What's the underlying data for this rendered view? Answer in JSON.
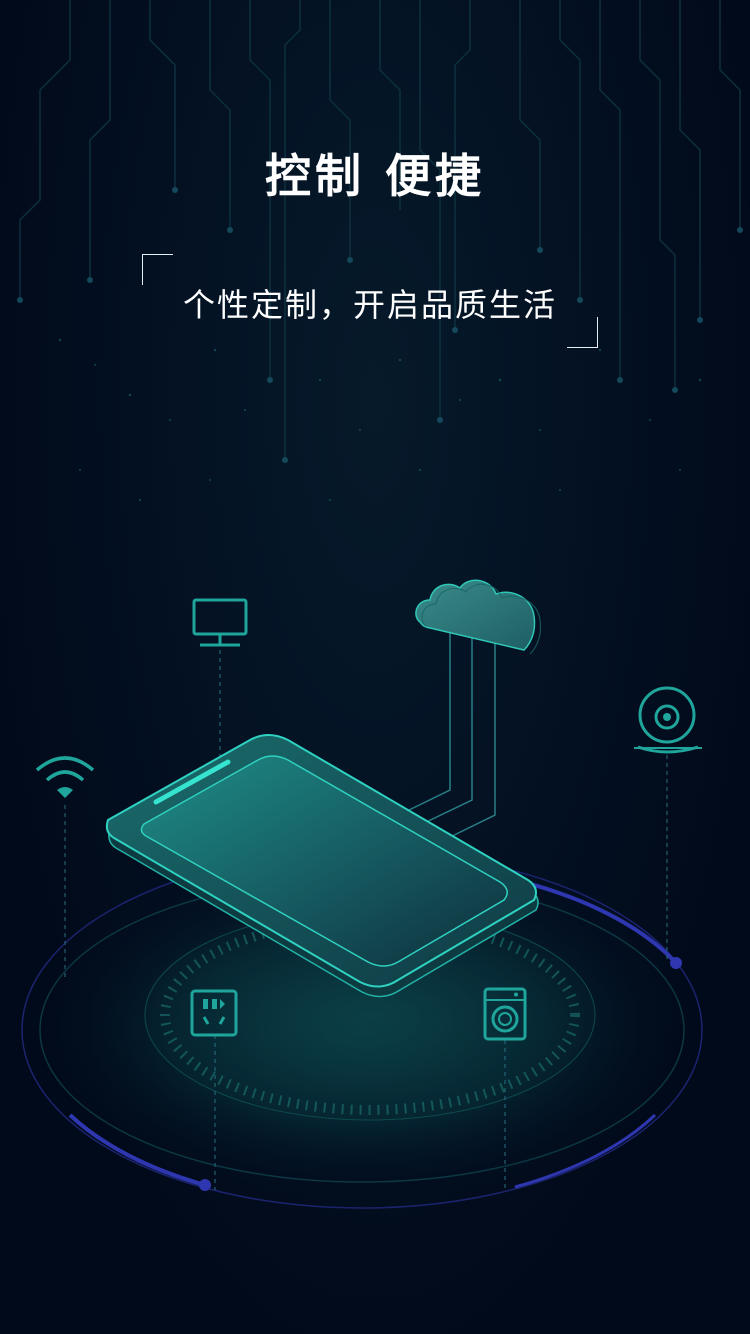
{
  "header": {
    "title": "控制 便捷",
    "subtitle": "个性定制，开启品质生活"
  },
  "illustration": {
    "icons": [
      "monitor-icon",
      "cloud-icon",
      "webcam-icon",
      "wifi-icon",
      "socket-icon",
      "washing-machine-icon",
      "smartphone-icon"
    ],
    "colors": {
      "background": "#010a1a",
      "teal": "#1fb5a8",
      "teal_dark": "#0f4a52",
      "ring": "#2a2fa0",
      "line": "#1d5a66"
    }
  }
}
